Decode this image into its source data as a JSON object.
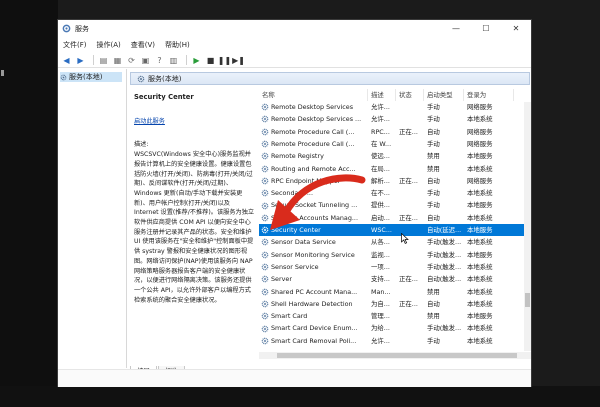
{
  "window": {
    "title": "服务"
  },
  "menu": [
    "文件(F)",
    "操作(A)",
    "查看(V)",
    "帮助(H)"
  ],
  "tree": {
    "item": "服务(本地)"
  },
  "pane": {
    "header": "服务(本地)"
  },
  "description": {
    "service_name": "Security Center",
    "start_link": "启动此服务",
    "label": "描述:",
    "text": "WSCSVC(Windows 安全中心)服务监视并报告计算机上的安全健康设置。健康设置包括防火墙(打开/关闭)、防病毒(打开/关闭/过期)、反间谍软件(打开/关闭/过期)、Windows 更新(自动/手动下载并安装更新)、用户帐户控制(打开/关闭)以及 Internet 设置(推荐/不推荐)。该服务为独立软件供应商提供 COM API 以便向安全中心服务注册并记录其产品的状态。安全和维护 UI 使用该服务在\"安全和维护\"控制面板中提供 systray 警报和安全健康状况的图形视图。网络访问保护(NAP)使用该服务向 NAP 网络策略服务器报告客户端的安全健康状况，以便进行网络隔离决策。该服务还提供一个公共 API，以允许外部客户以编程方式检索系统的聚合安全健康状况。"
  },
  "columns": [
    "名称",
    "描述",
    "状态",
    "启动类型",
    "登录为"
  ],
  "services": [
    {
      "name": "Remote Desktop Services",
      "desc": "允许...",
      "status": "",
      "startup": "手动",
      "logon": "网络服务"
    },
    {
      "name": "Remote Desktop Services ...",
      "desc": "允许...",
      "status": "",
      "startup": "手动",
      "logon": "本地系统"
    },
    {
      "name": "Remote Procedure Call (...",
      "desc": "RPC...",
      "status": "正在...",
      "startup": "自动",
      "logon": "网络服务"
    },
    {
      "name": "Remote Procedure Call (...",
      "desc": "在 W...",
      "status": "",
      "startup": "手动",
      "logon": "网络服务"
    },
    {
      "name": "Remote Registry",
      "desc": "使远...",
      "status": "",
      "startup": "禁用",
      "logon": "本地服务"
    },
    {
      "name": "Routing and Remote Acc...",
      "desc": "在局...",
      "status": "",
      "startup": "禁用",
      "logon": "本地系统"
    },
    {
      "name": "RPC Endpoint Mapper",
      "desc": "解析...",
      "status": "正在...",
      "startup": "自动",
      "logon": "网络服务"
    },
    {
      "name": "Secondary ...",
      "desc": "在不...",
      "status": "",
      "startup": "手动",
      "logon": "本地系统"
    },
    {
      "name": "Secure Socket Tunneling ...",
      "desc": "提供...",
      "status": "",
      "startup": "手动",
      "logon": "本地服务"
    },
    {
      "name": "Security Accounts Manag...",
      "desc": "启动...",
      "status": "正在...",
      "startup": "自动",
      "logon": "本地系统"
    },
    {
      "name": "Security Center",
      "desc": "WSC...",
      "status": "",
      "startup": "自动(延迟...",
      "logon": "本地服务",
      "selected": true
    },
    {
      "name": "Sensor Data Service",
      "desc": "从各...",
      "status": "",
      "startup": "手动(触发...",
      "logon": "本地系统"
    },
    {
      "name": "Sensor Monitoring Service",
      "desc": "监视...",
      "status": "",
      "startup": "手动(触发...",
      "logon": "本地服务"
    },
    {
      "name": "Sensor Service",
      "desc": "一项...",
      "status": "",
      "startup": "手动(触发...",
      "logon": "本地系统"
    },
    {
      "name": "Server",
      "desc": "支持...",
      "status": "正在...",
      "startup": "自动(触发...",
      "logon": "本地系统"
    },
    {
      "name": "Shared PC Account Mana...",
      "desc": "Man...",
      "status": "",
      "startup": "禁用",
      "logon": "本地系统"
    },
    {
      "name": "Shell Hardware Detection",
      "desc": "为自...",
      "status": "正在...",
      "startup": "自动",
      "logon": "本地系统"
    },
    {
      "name": "Smart Card",
      "desc": "管理...",
      "status": "",
      "startup": "禁用",
      "logon": "本地服务"
    },
    {
      "name": "Smart Card Device Enum...",
      "desc": "为给...",
      "status": "",
      "startup": "手动(触发...",
      "logon": "本地系统"
    },
    {
      "name": "Smart Card Removal Poli...",
      "desc": "允许...",
      "status": "",
      "startup": "手动",
      "logon": "本地系统"
    }
  ],
  "tabs": [
    "扩展",
    "标准"
  ],
  "colors": {
    "selection": "#0078d7",
    "arrow": "#d92b1c",
    "link": "#0645ad"
  },
  "icons": [
    "services-icon",
    "gear-icon",
    "back-icon",
    "forward-icon",
    "play-icon",
    "stop-icon",
    "pause-icon",
    "restart-icon"
  ]
}
